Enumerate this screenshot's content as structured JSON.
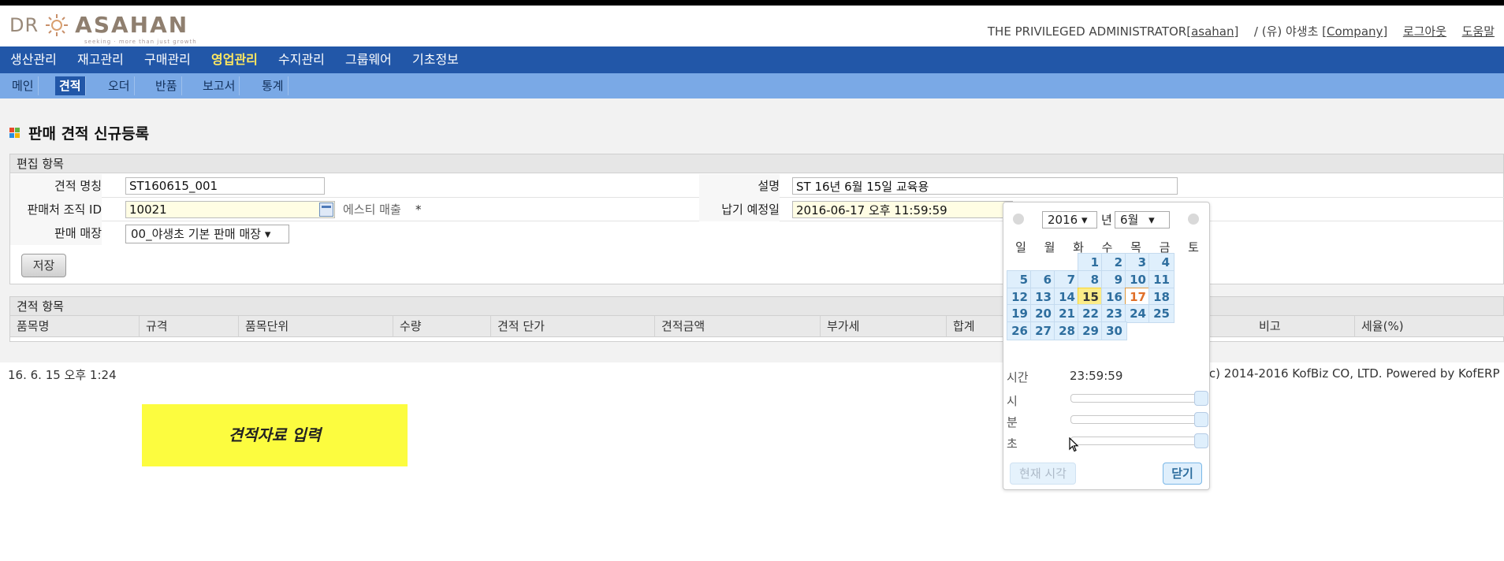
{
  "header": {
    "logo_dr": "DR",
    "logo_name": "ASAHAN",
    "logo_tagline": "seeking  ·  more than just growth",
    "user_prefix": "THE PRIVILEGED ADMINISTRATOR[",
    "user_id": "asahan",
    "user_suffix": "]",
    "company_prefix": "/ (유) 야생초 [",
    "company_link": "Company",
    "company_suffix": "]",
    "logout": "로그아웃",
    "help": "도움말"
  },
  "main_nav": {
    "items": [
      "생산관리",
      "재고관리",
      "구매관리",
      "영업관리",
      "수지관리",
      "그룹웨어",
      "기초정보"
    ],
    "active": "영업관리"
  },
  "sub_nav": {
    "items": [
      "메인",
      "견적",
      "오더",
      "반품",
      "보고서",
      "통계"
    ],
    "active": "견적"
  },
  "page": {
    "title": "판매 견적 신규등록"
  },
  "edit_section": {
    "header": "편집 항목",
    "quote_name_label": "견적 명칭",
    "quote_name_value": "ST160615_001",
    "description_label": "설명",
    "description_value": "ST 16년 6월 15일 교육용",
    "seller_org_label": "판매처 조직 ID",
    "seller_org_value": "10021",
    "seller_org_name": "에스티 매출",
    "required_mark": "*",
    "delivery_date_label": "납기 예정일",
    "delivery_date_value": "2016-06-17 오후 11:59:59",
    "store_label": "판매 매장",
    "store_value": "00_야생초 기본 판매 매장 ▾",
    "save_button": "저장"
  },
  "items_section": {
    "header": "견적 항목",
    "columns": [
      "품목명",
      "규격",
      "품목단위",
      "수량",
      "견적 단가",
      "견적금액",
      "부가세",
      "합계",
      "",
      "비고",
      "세율(%)"
    ]
  },
  "footer": {
    "timestamp": "16. 6. 15 오후 1:24",
    "copyright": "Copyright (c) 2014-2016 KofBiz CO, LTD. Powered by KofERP"
  },
  "annotation": {
    "text": "견적자료 입력"
  },
  "calendar": {
    "year": "2016",
    "year_suffix": "년",
    "month": "6월",
    "dropdown_arrow": "▾",
    "weekdays": [
      "일",
      "월",
      "화",
      "수",
      "목",
      "금",
      "토"
    ],
    "weeks": [
      [
        "",
        "",
        "",
        "1",
        "2",
        "3",
        "4"
      ],
      [
        "5",
        "6",
        "7",
        "8",
        "9",
        "10",
        "11"
      ],
      [
        "12",
        "13",
        "14",
        "15",
        "16",
        "17",
        "18"
      ],
      [
        "19",
        "20",
        "21",
        "22",
        "23",
        "24",
        "25"
      ],
      [
        "26",
        "27",
        "28",
        "29",
        "30",
        "",
        ""
      ]
    ],
    "today": "15",
    "selected": "17",
    "time_label": "시간",
    "time_value": "23:59:59",
    "hour_label": "시",
    "minute_label": "분",
    "second_label": "초",
    "hour_level": 1.0,
    "minute_level": 1.0,
    "second_level": 1.0,
    "now_button": "현재 시각",
    "close_button": "닫기"
  }
}
